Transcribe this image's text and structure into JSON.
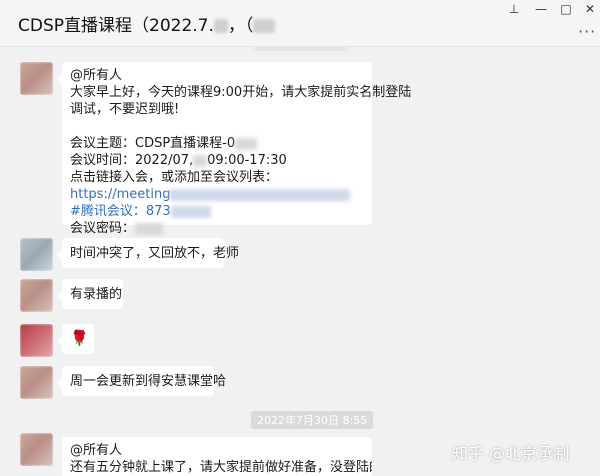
{
  "window": {
    "title": "CDSP直播课程（2022.7.",
    "title_tail": "，（",
    "controls": {
      "pin": "⊥",
      "minimize": "—",
      "maximize": "□",
      "close": "✕"
    },
    "more": "···"
  },
  "messages": [
    {
      "lines": [
        "@所有人",
        "大家早上好，今天的课程9:00开始，请大家提前实名制登陆",
        "调试，不要迟到哦!",
        "",
        "会议主题：CDSP直播课程-0",
        "会议时间：2022/07,",
        "09:00-17:30",
        "点击链接入会，或添加至会议列表：",
        "https://meeting",
        "#腾讯会议：873",
        "会议密码："
      ]
    },
    {
      "text": "时间冲突了，又回放不，老师"
    },
    {
      "text": "有录播的"
    },
    {
      "text": "🌹"
    },
    {
      "text": "周一会更新到得安慧课堂哈"
    },
    {
      "lines": [
        "@所有人",
        "还有五分钟就上课了，请大家提前做好准备，没登陆的同学"
      ]
    }
  ],
  "timestamp": "2022年7月30日 8:55",
  "watermark": "知乎 @北京承制",
  "colors": {
    "link": "#3370b8",
    "background": "#f1f1f1",
    "bubble": "#ffffff"
  }
}
